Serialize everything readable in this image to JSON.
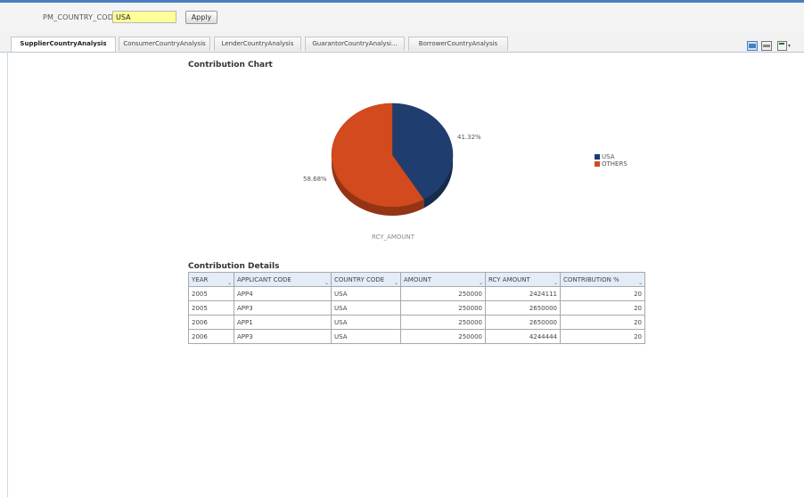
{
  "parameter": {
    "label": "PM_COUNTRY_CODE",
    "value": "USA",
    "apply_label": "Apply"
  },
  "tabs": [
    {
      "label": "SupplierCountryAnalysis",
      "active": true
    },
    {
      "label": "ConsumerCountryAnalysis",
      "active": false
    },
    {
      "label": "LenderCountryAnalysis",
      "active": false
    },
    {
      "label": "GuarantorCountryAnalysi...",
      "active": false
    },
    {
      "label": "BorrowerCountryAnalysis",
      "active": false
    }
  ],
  "toolbar": {
    "icons": [
      "refresh-icon",
      "print-icon",
      "export-icon"
    ]
  },
  "chart_section": {
    "title": "Contribution Chart"
  },
  "chart_data": {
    "type": "pie",
    "categories": [
      "USA",
      "OTHERS"
    ],
    "values": [
      41.32,
      58.68
    ],
    "value_labels": [
      "41.32%",
      "58.68%"
    ],
    "colors": [
      "#1f3d6e",
      "#d24a1e"
    ],
    "xlabel": "RCY_AMOUNT",
    "legend": "right"
  },
  "details_section": {
    "title": "Contribution Details",
    "columns": [
      "YEAR",
      "APPLICANT CODE",
      "COUNTRY CODE",
      "AMOUNT",
      "RCY AMOUNT",
      "CONTRIBUTION %"
    ],
    "rows": [
      [
        "2005",
        "APP4",
        "USA",
        "250000",
        "2424111",
        "20"
      ],
      [
        "2005",
        "APP3",
        "USA",
        "250000",
        "2650000",
        "20"
      ],
      [
        "2006",
        "APP1",
        "USA",
        "250000",
        "2650000",
        "20"
      ],
      [
        "2006",
        "APP3",
        "USA",
        "250000",
        "4244444",
        "20"
      ]
    ]
  }
}
